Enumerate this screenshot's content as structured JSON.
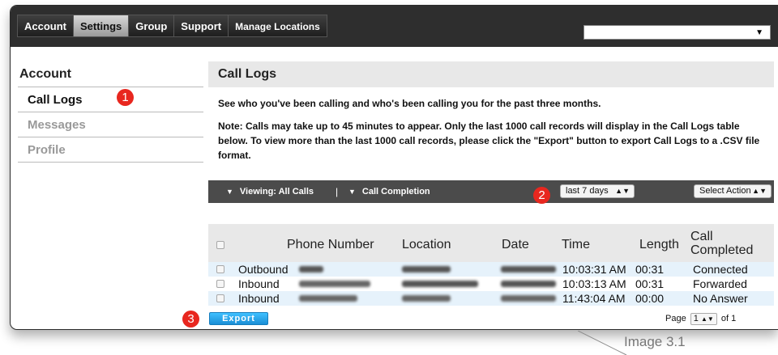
{
  "nav": {
    "tabs": [
      "Account",
      "Settings",
      "Group",
      "Support",
      "Manage Locations"
    ],
    "active_tab": "Settings",
    "location_select_value": "",
    "location_select_icon": "caret-down-icon"
  },
  "sidebar": {
    "heading": "Account",
    "items": [
      {
        "label": "Call Logs",
        "active": true
      },
      {
        "label": "Messages",
        "active": false
      },
      {
        "label": "Profile",
        "active": false
      }
    ]
  },
  "callouts": [
    "1",
    "2",
    "3"
  ],
  "main": {
    "title": "Call Logs",
    "description": "See who you've been calling and who's been calling you for the past three months.",
    "note": "Note: Calls may take up to 45 minutes to appear. Only the last 1000 call records will display in the Call Logs table below. To view more than the last 1000 call records, please click the \"Export\" button to export Call Logs to a .CSV file format."
  },
  "toolbar": {
    "viewing_label": "Viewing: All Calls",
    "separator": "|",
    "completion_label": "Call Completion",
    "range_select": "last 7 days",
    "action_select": "Select Action"
  },
  "table": {
    "columns": [
      "Phone Number",
      "Location",
      "Date",
      "Time",
      "Length",
      "Call Completed"
    ],
    "rows": [
      {
        "direction": "Outbound",
        "phone": "9999",
        "location": "UNKNOWN",
        "date": "7/26/2016",
        "time": "10:03:31 AM",
        "length": "00:31",
        "completed": "Connected"
      },
      {
        "direction": "Inbound",
        "phone": "",
        "location": "",
        "date": "",
        "time": "10:03:13 AM",
        "length": "00:31",
        "completed": "Forwarded"
      },
      {
        "direction": "Inbound",
        "phone": "",
        "location": "",
        "date": "",
        "time": "11:43:04 AM",
        "length": "00:00",
        "completed": "No Answer"
      }
    ]
  },
  "footer": {
    "export_label": "Export",
    "page_label": "Page",
    "page_value": "1",
    "page_of": "of 1"
  },
  "caption": "Image 3.1",
  "colors": {
    "nav_bg": "#2e2e2e",
    "toolbar_bg": "#4b4b4b",
    "callout_red": "#e8271f",
    "export_blue": "#1b8ed6",
    "row_alt": "#e6f2fb"
  }
}
